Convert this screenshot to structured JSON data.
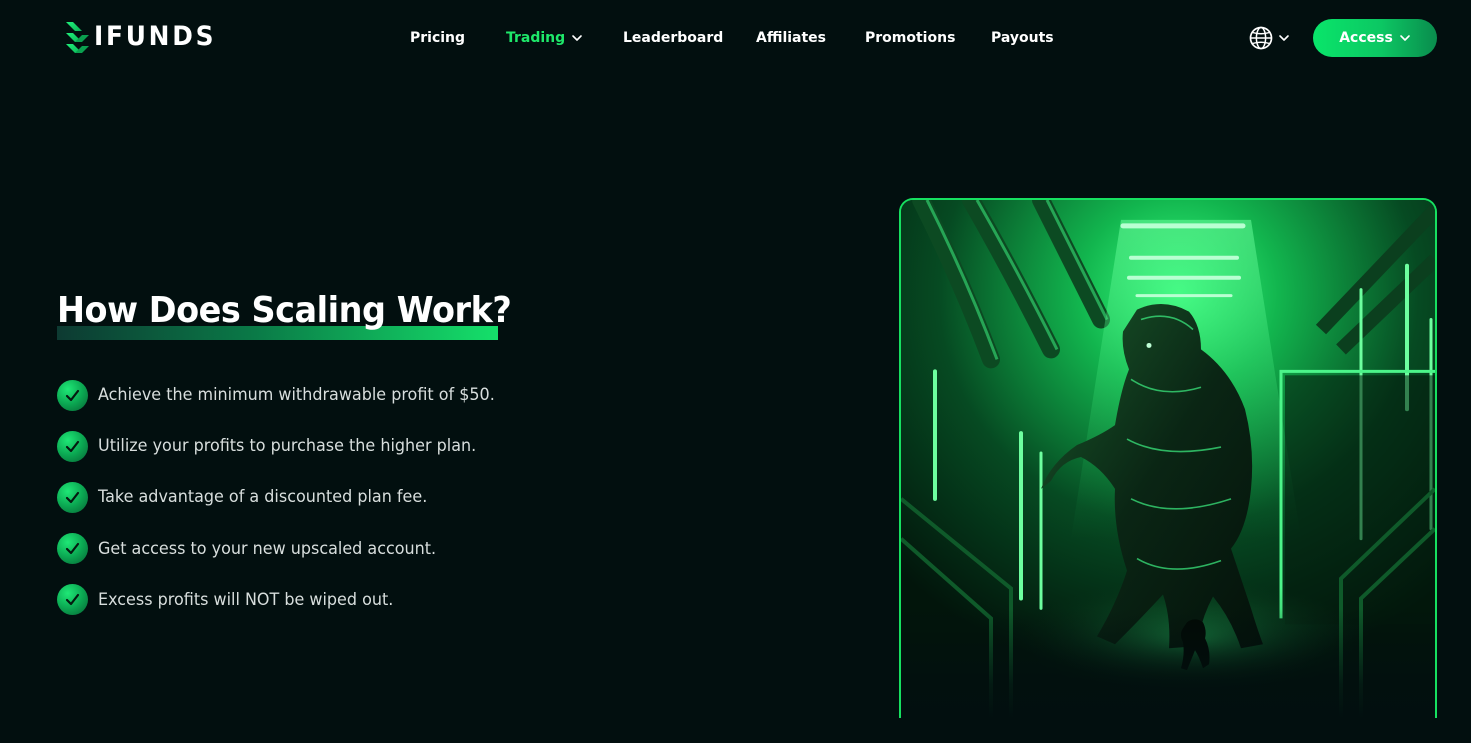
{
  "brand": {
    "name": "IFUNDS",
    "accent": "#1ee86a",
    "background": "#020f0f"
  },
  "nav": {
    "items": [
      {
        "label": "Pricing",
        "has_dropdown": false,
        "active": false
      },
      {
        "label": "Trading",
        "has_dropdown": true,
        "active": true
      },
      {
        "label": "Leaderboard",
        "has_dropdown": false,
        "active": false
      },
      {
        "label": "Affiliates",
        "has_dropdown": false,
        "active": false
      },
      {
        "label": "Promotions",
        "has_dropdown": false,
        "active": false
      },
      {
        "label": "Payouts",
        "has_dropdown": false,
        "active": false
      }
    ],
    "language_icon": "globe-icon",
    "access_label": "Access"
  },
  "section": {
    "title": "How Does Scaling Work?",
    "steps": [
      "Achieve the minimum withdrawable profit of $50.",
      "Utilize your profits to purchase the higher plan.",
      "Take advantage of a discounted plan fee.",
      "Get access to your new upscaled account.",
      "Excess profits will NOT be wiped out."
    ],
    "step_icon": "check-circle-icon"
  }
}
